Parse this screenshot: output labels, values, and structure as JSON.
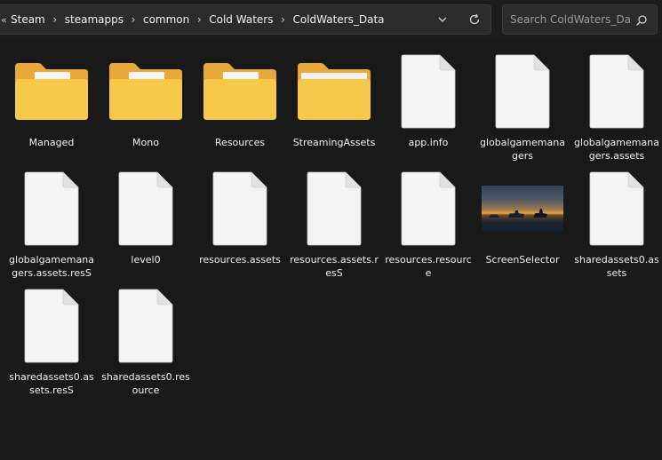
{
  "breadcrumb": {
    "overflow": "«",
    "items": [
      "Steam",
      "steamapps",
      "common",
      "Cold Waters",
      "ColdWaters_Data"
    ],
    "separator": "›"
  },
  "search": {
    "placeholder": "Search ColdWaters_Data"
  },
  "files": [
    {
      "name": "Managed",
      "kind": "folder-gear"
    },
    {
      "name": "Mono",
      "kind": "folder-gear"
    },
    {
      "name": "Resources",
      "kind": "folder-doc"
    },
    {
      "name": "StreamingAssets",
      "kind": "folder"
    },
    {
      "name": "app.info",
      "kind": "file"
    },
    {
      "name": "globalgamemanagers",
      "kind": "file"
    },
    {
      "name": "globalgamemanagers.assets",
      "kind": "file"
    },
    {
      "name": "globalgamemanagers.assets.resS",
      "kind": "file"
    },
    {
      "name": "level0",
      "kind": "file"
    },
    {
      "name": "resources.assets",
      "kind": "file"
    },
    {
      "name": "resources.assets.resS",
      "kind": "file"
    },
    {
      "name": "resources.resource",
      "kind": "file"
    },
    {
      "name": "ScreenSelector",
      "kind": "image"
    },
    {
      "name": "sharedassets0.assets",
      "kind": "file"
    },
    {
      "name": "sharedassets0.assets.resS",
      "kind": "file"
    },
    {
      "name": "sharedassets0.resource",
      "kind": "file"
    }
  ],
  "colors": {
    "background": "#191919",
    "folder_front": "#f7c948",
    "folder_back": "#e8a83a",
    "file": "#f5f5f5"
  },
  "icons": {
    "refresh": "refresh-icon",
    "dropdown": "chevron-down-icon",
    "search": "search-icon"
  }
}
